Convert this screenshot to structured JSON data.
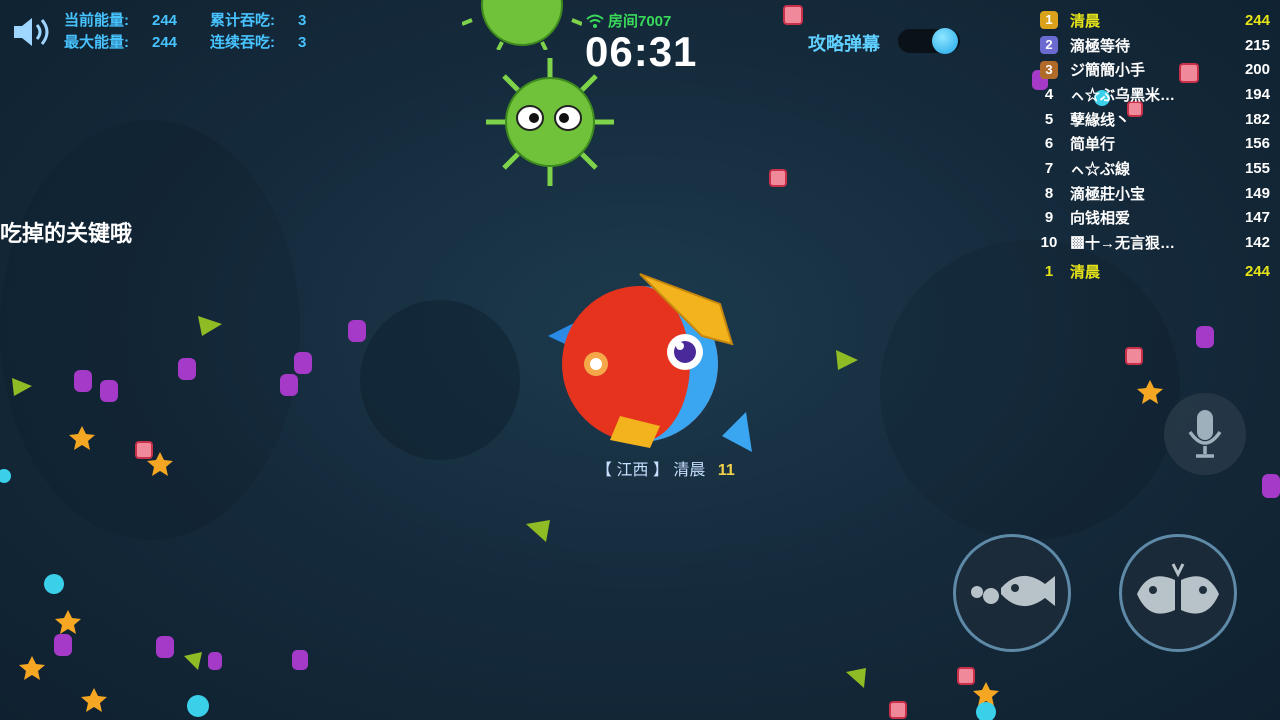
{
  "hud": {
    "current_energy_label": "当前能量:",
    "current_energy_value": "244",
    "total_eaten_label": "累计吞吃:",
    "total_eaten_value": "3",
    "max_energy_label": "最大能量:",
    "max_energy_value": "244",
    "streak_eaten_label": "连续吞吃:",
    "streak_eaten_value": "3"
  },
  "room": {
    "label": "房间7007",
    "timer": "06:31"
  },
  "barrage": {
    "label": "攻略弹幕",
    "enabled": true
  },
  "hint_text": "吃掉的关键哦",
  "leaderboard": {
    "rows": [
      {
        "rank": "1",
        "name": "清晨",
        "score": "244"
      },
      {
        "rank": "2",
        "name": "滴極等待",
        "score": "215"
      },
      {
        "rank": "3",
        "name": "ジ簡簡小手",
        "score": "200"
      },
      {
        "rank": "4",
        "name": "ㇸ☆ぶ乌黑米…",
        "score": "194"
      },
      {
        "rank": "5",
        "name": "孽緣线丶",
        "score": "182"
      },
      {
        "rank": "6",
        "name": "简单行",
        "score": "156"
      },
      {
        "rank": "7",
        "name": "ㇸ☆ぶ線",
        "score": "155"
      },
      {
        "rank": "8",
        "name": "滴極莊小宝",
        "score": "149"
      },
      {
        "rank": "9",
        "name": "向钱相爱",
        "score": "147"
      },
      {
        "rank": "10",
        "name": "▩十→无言狠…",
        "score": "142"
      }
    ],
    "self": {
      "rank": "1",
      "name": "清晨",
      "score": "244"
    }
  },
  "player": {
    "region": "【 江西 】",
    "name": "清晨",
    "level": "11"
  },
  "colors": {
    "accent_blue": "#47c3ff",
    "self_yellow": "#e6e418",
    "wifi_green": "#39d95a"
  }
}
